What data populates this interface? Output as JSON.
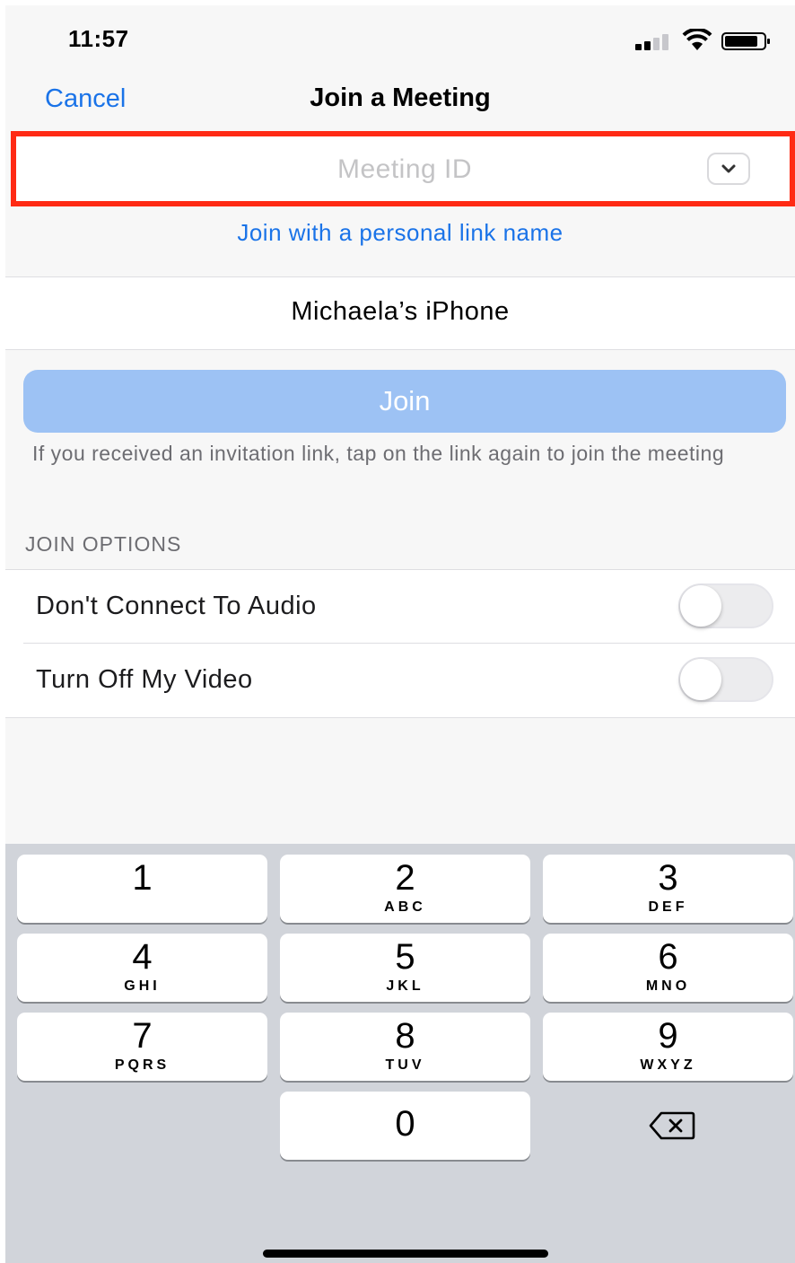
{
  "status_bar": {
    "time": "11:57"
  },
  "nav": {
    "cancel": "Cancel",
    "title": "Join a Meeting"
  },
  "meeting_id": {
    "placeholder": "Meeting ID",
    "value": ""
  },
  "personal_link": "Join with a personal link name",
  "display_name": "Michaela’s iPhone",
  "join_button": "Join",
  "hint": "If you received an invitation link, tap on the link again to join the meeting",
  "join_options": {
    "header": "JOIN OPTIONS",
    "items": [
      {
        "label": "Don't Connect To Audio",
        "enabled": false
      },
      {
        "label": "Turn Off My Video",
        "enabled": false
      }
    ]
  },
  "keypad": [
    {
      "num": "1",
      "letters": ""
    },
    {
      "num": "2",
      "letters": "ABC"
    },
    {
      "num": "3",
      "letters": "DEF"
    },
    {
      "num": "4",
      "letters": "GHI"
    },
    {
      "num": "5",
      "letters": "JKL"
    },
    {
      "num": "6",
      "letters": "MNO"
    },
    {
      "num": "7",
      "letters": "PQRS"
    },
    {
      "num": "8",
      "letters": "TUV"
    },
    {
      "num": "9",
      "letters": "WXYZ"
    },
    {
      "num": "0",
      "letters": ""
    }
  ],
  "colors": {
    "accent": "#1a73e8",
    "highlight_border": "#ff2a14",
    "join_disabled": "#9dc2f4"
  },
  "icons": [
    "signal-icon",
    "wifi-icon",
    "battery-icon",
    "chevron-down-icon",
    "backspace-icon"
  ]
}
